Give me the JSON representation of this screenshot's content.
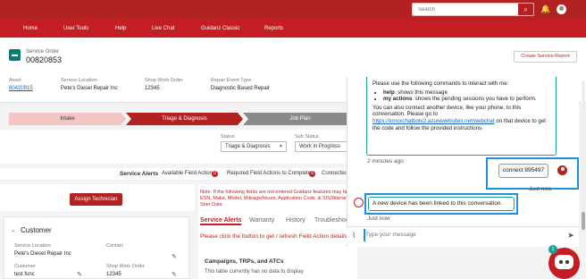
{
  "topbar": {
    "search_placeholder": "Search",
    "search_btn": "⌕",
    "bell": "🔔"
  },
  "nav": {
    "items": [
      "Home",
      "User Tools",
      "Help",
      "Live Chat",
      "Guidanz Classic",
      "Reports"
    ]
  },
  "service_order": {
    "label": "Service Order",
    "number": "00820853",
    "create_button": "Create Service Report",
    "fields": [
      {
        "label": "Asset",
        "value": "80420915"
      },
      {
        "label": "Service Location",
        "value": "Pete's Diesel Repair Inc"
      },
      {
        "label": "Shop Work Order",
        "value": "12345"
      },
      {
        "label": "Repair Event Type",
        "value": "Diagnostic Based Repair"
      }
    ]
  },
  "steps": [
    "Intake",
    "Triage & Diagnosis",
    "Job Plan"
  ],
  "status": {
    "status_label": "Status",
    "status_value": "Triage & Diagnosis",
    "substatus_label": "Sub Status",
    "substatus_value": "Work in Progress"
  },
  "alerts": {
    "title": "Service Alerts",
    "available": "Available Field Actions:",
    "available_count": "0",
    "required": "Required Field Actions to Complete:",
    "required_count": "0",
    "connected": "Connected"
  },
  "assign_button": "Assign Technician",
  "customer": {
    "title": "Customer",
    "service_location_label": "Service Location",
    "service_location_value": "Pete's Diesel Repair Inc",
    "contact_label": "Contact",
    "customer_label": "Customer",
    "customer_value": "test func",
    "shop_wo_label": "Shop Work Order",
    "shop_wo_value": "12345"
  },
  "right": {
    "note": "Note: If the following fields are not entered Guidanz features may fail: ESN, Make, Model, Mileage/Hours, Application Code, & SIS/Warranty Start Date",
    "tabs": [
      "Service Alerts",
      "Warranty",
      "History",
      "Troubleshoo"
    ],
    "refresh_msg": "Please click the button to get / refresh Field Action details.",
    "section_title": "Campaigns, TRPs, and ATCs",
    "section_empty": "This table currently has no data to display"
  },
  "chat": {
    "intro": "Please use the following commands to interact with me:",
    "cmd1_key": "help",
    "cmd1_text": ": shows this message",
    "cmd2_key": "my actions",
    "cmd2_text": ": shows the pending sessions you have to perform.",
    "connect_text": "You can also connect another device, like your phone, to this conversation. Please go to",
    "link": "https://ionoxchatbotv2.azurewebsites.net/webchat",
    "link_suffix": " on that device to get the code and follow the provided instructions.",
    "time1": "2 minutes ago",
    "user_msg": "connect 895497",
    "time2": "Just now",
    "bot_msg": "A new device has been linked to this conversation.",
    "time3": "Just now",
    "input_placeholder": "Type your message",
    "fab_badge": "1"
  }
}
